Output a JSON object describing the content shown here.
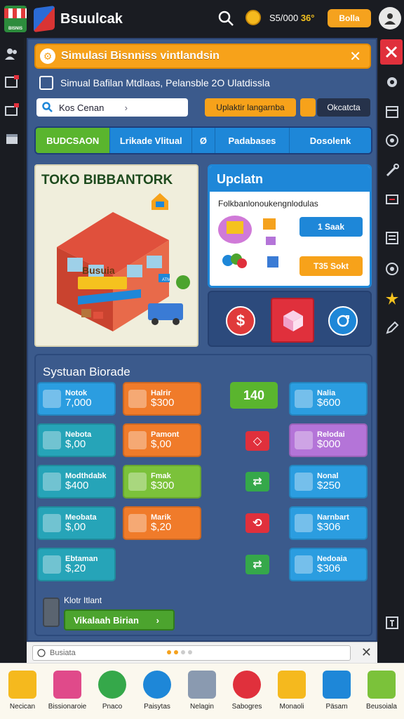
{
  "topbar": {
    "left_icon_label": "BISNIS",
    "title": "Bsuulcak",
    "money_prefix": "S5/000",
    "money_value": "36°",
    "button_label": "Bolla",
    "icons": [
      "store-icon",
      "app-logo-icon",
      "search-icon",
      "coin-icon",
      "avatar-icon"
    ]
  },
  "notice": {
    "text": "Simulasi Bisnniss vintlandsin",
    "close": "✕"
  },
  "subheader": {
    "text": "Simual Bafilan Mtdlaas, Pelansble 2O Ulatdissla"
  },
  "toolbar": {
    "search_value": "Kos Cenan",
    "primary_button": "Uplaktir langarnba",
    "secondary_button": "Okcatcta"
  },
  "tabs": [
    {
      "label": "BUDCSAON",
      "active": true
    },
    {
      "label": "Lrikade Vlitual",
      "active": false
    },
    {
      "label": "Ø",
      "active": false
    },
    {
      "label": "Padabases",
      "active": false
    },
    {
      "label": "Dosolenk",
      "active": false
    }
  ],
  "store": {
    "title": "TOKO BIBBANTORK",
    "sign": "Busuia",
    "side_sign": "ATM"
  },
  "update": {
    "title": "Upclatn",
    "text": "Folkbanlonoukengnlodulas",
    "button1": "1 Saak",
    "button2": "T35 Sokt"
  },
  "system": {
    "title": "Systuan Biorade",
    "left_cards": [
      {
        "name": "Notok",
        "price": "7,000",
        "color": "#2b9de0"
      },
      {
        "name": "Nebota",
        "price": "$,00",
        "color": "#26a4b8"
      },
      {
        "name": "Modthdabk",
        "price": "$400",
        "color": "#26a4b8"
      },
      {
        "name": "Meobata",
        "price": "$,00",
        "color": "#26a4b8"
      },
      {
        "name": "Ebtaman",
        "price": "$,20",
        "color": "#26a4b8"
      }
    ],
    "mid_cards": [
      {
        "name": "Halrir",
        "price": "$300",
        "color": "#f07b2a"
      },
      {
        "name": "Pamont",
        "price": "$,00",
        "color": "#f07b2a"
      },
      {
        "name": "Fmak",
        "price": "$300",
        "color": "#7bc23a"
      },
      {
        "name": "Marik",
        "price": "$,20",
        "color": "#f07b2a"
      }
    ],
    "badge": "140",
    "middle_buttons": [
      {
        "symbol": "◇",
        "color": "#e0303c"
      },
      {
        "symbol": "⇄",
        "color": "#35a84a"
      },
      {
        "symbol": "⟲",
        "color": "#e0303c"
      },
      {
        "symbol": "⇄",
        "color": "#35a84a"
      }
    ],
    "right_cards": [
      {
        "name": "Nalia",
        "price": "$600",
        "color": "#2b9de0"
      },
      {
        "name": "Relodai",
        "price": "$000",
        "color": "#b474d8"
      },
      {
        "name": "Nonal",
        "price": "$250",
        "color": "#2b9de0"
      },
      {
        "name": "Narnbart",
        "price": "$306",
        "color": "#2b9de0"
      },
      {
        "name": "Nedoaia",
        "price": "$306",
        "color": "#2b9de0"
      }
    ],
    "footer_label": "Klotr Itlant",
    "footer_button": "Vikalaah Birian",
    "footer_arrow": "›"
  },
  "browserbar": {
    "text": "Busiata",
    "close": "✕"
  },
  "dock": [
    {
      "label": "Necican",
      "color": "#f5b91e"
    },
    {
      "label": "Bissionaroie",
      "color": "#e04a8a"
    },
    {
      "label": "Pnaco",
      "color": "#35a84a"
    },
    {
      "label": "Paisytas",
      "color": "#1e87d8"
    },
    {
      "label": "Nelagin",
      "color": "#8a9ab0"
    },
    {
      "label": "Sabogres",
      "color": "#e0303c"
    },
    {
      "label": "Monaoli",
      "color": "#f5b91e"
    },
    {
      "label": "Päsam",
      "color": "#1e87d8"
    },
    {
      "label": "Beusoiala",
      "color": "#7bc23a"
    }
  ]
}
